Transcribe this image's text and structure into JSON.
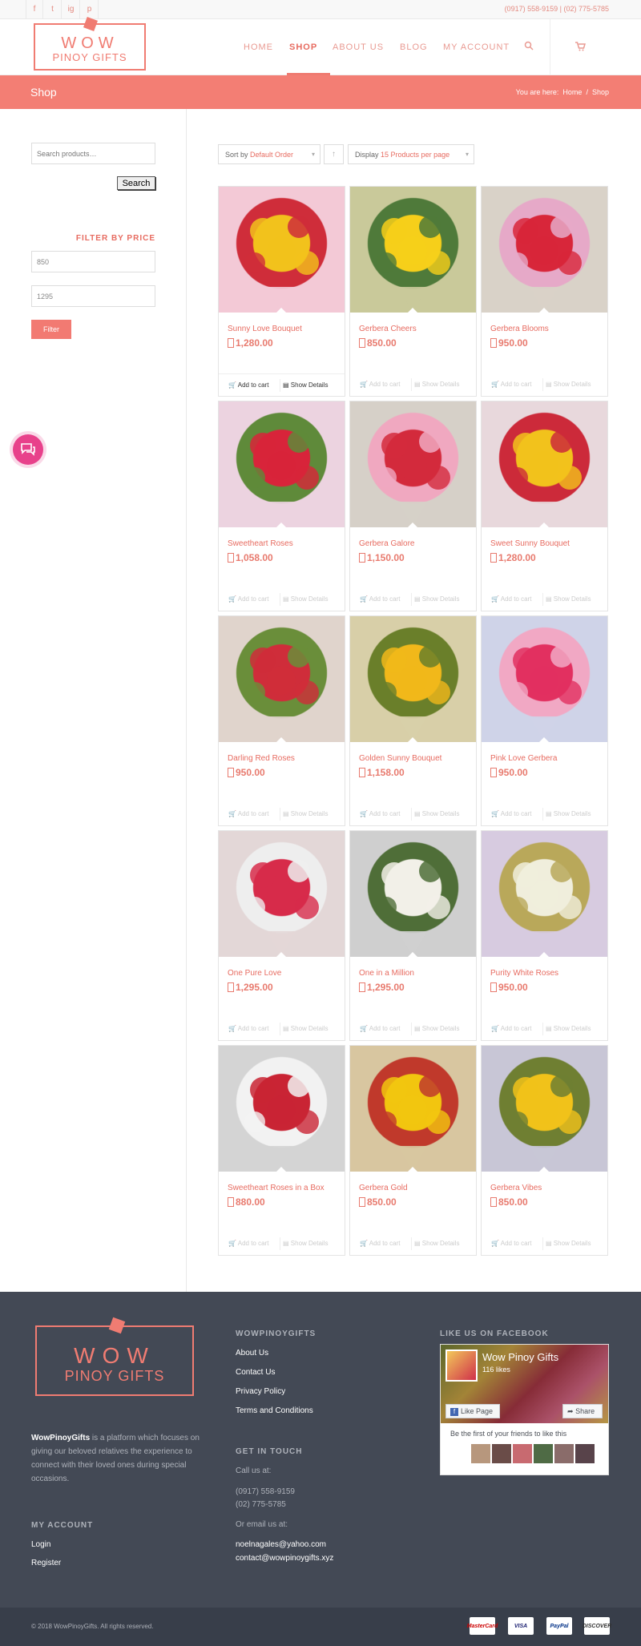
{
  "topbar": {
    "social": [
      "f",
      "t",
      "ig",
      "p"
    ],
    "phone": "(0917) 558-9159 | (02) 775-5785"
  },
  "header": {
    "logo_line1": "WOW",
    "logo_line2": "PINOY GIFTS",
    "nav": [
      {
        "label": "HOME"
      },
      {
        "label": "SHOP"
      },
      {
        "label": "ABOUT US"
      },
      {
        "label": "BLOG"
      },
      {
        "label": "MY ACCOUNT"
      }
    ],
    "search_icon": "search-icon",
    "cart_icon": "cart-icon"
  },
  "title_bar": {
    "title": "Shop",
    "breadcrumb_prefix": "You are here:",
    "breadcrumb_home": "Home",
    "breadcrumb_sep": "/",
    "breadcrumb_current": "Shop"
  },
  "sidebar": {
    "search_placeholder": "Search products…",
    "search_button": "Search",
    "filter_title": "FILTER BY PRICE",
    "min_price": "850",
    "max_price": "1295",
    "filter_button": "Filter"
  },
  "toolbar": {
    "sort_prefix": "Sort by",
    "sort_value": "Default Order",
    "display_prefix": "Display",
    "display_value": "15 Products per page"
  },
  "products": [
    {
      "name": "Sunny Love Bouquet",
      "price": "1,280.00",
      "add": "Add to cart",
      "details": "Show Details",
      "active": true
    },
    {
      "name": "Gerbera Cheers",
      "price": "850.00",
      "add": "Add to cart",
      "details": "Show Details"
    },
    {
      "name": "Gerbera Blooms",
      "price": "950.00",
      "add": "Add to cart",
      "details": "Show Details"
    },
    {
      "name": "Sweetheart Roses",
      "price": "1,058.00",
      "add": "Add to cart",
      "details": "Show Details"
    },
    {
      "name": "Gerbera Galore",
      "price": "1,150.00",
      "add": "Add to cart",
      "details": "Show Details"
    },
    {
      "name": "Sweet Sunny Bouquet",
      "price": "1,280.00",
      "add": "Add to cart",
      "details": "Show Details"
    },
    {
      "name": "Darling Red Roses",
      "price": "950.00",
      "add": "Add to cart",
      "details": "Show Details"
    },
    {
      "name": "Golden Sunny Bouquet",
      "price": "1,158.00",
      "add": "Add to cart",
      "details": "Show Details"
    },
    {
      "name": "Pink Love Gerbera",
      "price": "950.00",
      "add": "Add to cart",
      "details": "Show Details"
    },
    {
      "name": "One Pure Love",
      "price": "1,295.00",
      "add": "Add to cart",
      "details": "Show Details"
    },
    {
      "name": "One in a Million",
      "price": "1,295.00",
      "add": "Add to cart",
      "details": "Show Details"
    },
    {
      "name": "Purity White Roses",
      "price": "950.00",
      "add": "Add to cart",
      "details": "Show Details"
    },
    {
      "name": "Sweetheart Roses in a Box",
      "price": "880.00",
      "add": "Add to cart",
      "details": "Show Details"
    },
    {
      "name": "Gerbera Gold",
      "price": "850.00",
      "add": "Add to cart",
      "details": "Show Details"
    },
    {
      "name": "Gerbera Vibes",
      "price": "850.00",
      "add": "Add to cart",
      "details": "Show Details"
    }
  ],
  "footer": {
    "logo_line1": "WOW",
    "logo_line2": "PINOY GIFTS",
    "about_brand": "WowPinoyGifts",
    "about_text": " is a platform which focuses on giving our beloved relatives the experience to connect with their loved ones during special occasions.",
    "my_account_title": "MY ACCOUNT",
    "login": "Login",
    "register": "Register",
    "links_title": "WOWPINOYGIFTS",
    "links": [
      "About Us",
      "Contact Us",
      "Privacy Policy",
      "Terms and Conditions"
    ],
    "contact_title": "GET IN TOUCH",
    "call_label": "Call us at:",
    "phone1": "(0917) 558-9159",
    "phone2": "(02) 775-5785",
    "email_label": "Or email us at:",
    "email1": "noelnagales@yahoo.com",
    "email2": "contact@wowpinoygifts.xyz",
    "fb_title": "LIKE US ON FACEBOOK",
    "fb_page_name": "Wow Pinoy Gifts",
    "fb_likes": "116 likes",
    "fb_like_button": "Like Page",
    "fb_share_button": "Share",
    "fb_friends_text": "Be the first of your friends to like this",
    "copyright": "© 2018 WowPinoyGifts. All rights reserved.",
    "payments": [
      "MasterCard",
      "VISA",
      "PayPal",
      "DISCOVER"
    ]
  },
  "colors": {
    "accent": "#f37e74",
    "footer_bg": "#434955",
    "chat_bubble": "#e8418b"
  }
}
